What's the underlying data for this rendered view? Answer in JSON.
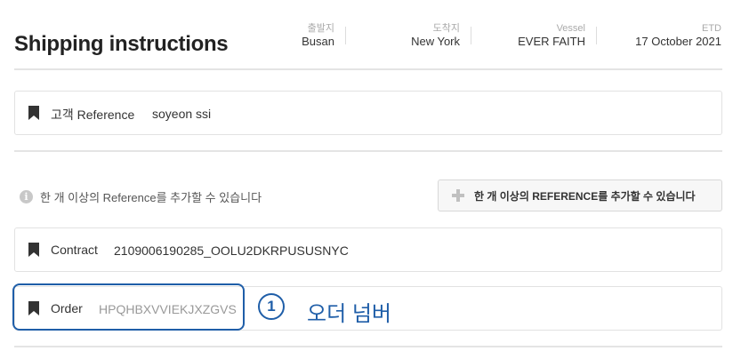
{
  "header": {
    "title": "Shipping instructions",
    "departure_label": "출발지",
    "departure_value": "Busan",
    "arrival_label": "도착지",
    "arrival_value": "New York",
    "vessel_label": "Vessel",
    "vessel_value": "EVER FAITH",
    "etd_label": "ETD",
    "etd_value": "17 October 2021"
  },
  "customer_reference": {
    "label": "고객 Reference",
    "value": "soyeon ssi"
  },
  "info_text": "한 개 이상의 Reference를 추가할 수 있습니다",
  "add_button": {
    "label": "한 개 이상의 REFERENCE를 추가할 수 있습니다",
    "icon": "plus-icon"
  },
  "contract": {
    "label": "Contract",
    "value": "2109006190285_OOLU2DKRPUSUSNYC"
  },
  "order": {
    "label": "Order",
    "placeholder": "HPQHBXVVIEKJXZGVS"
  },
  "annotation": {
    "step_number": "1",
    "text": "오더 넘버",
    "color": "#1f5ea8"
  }
}
